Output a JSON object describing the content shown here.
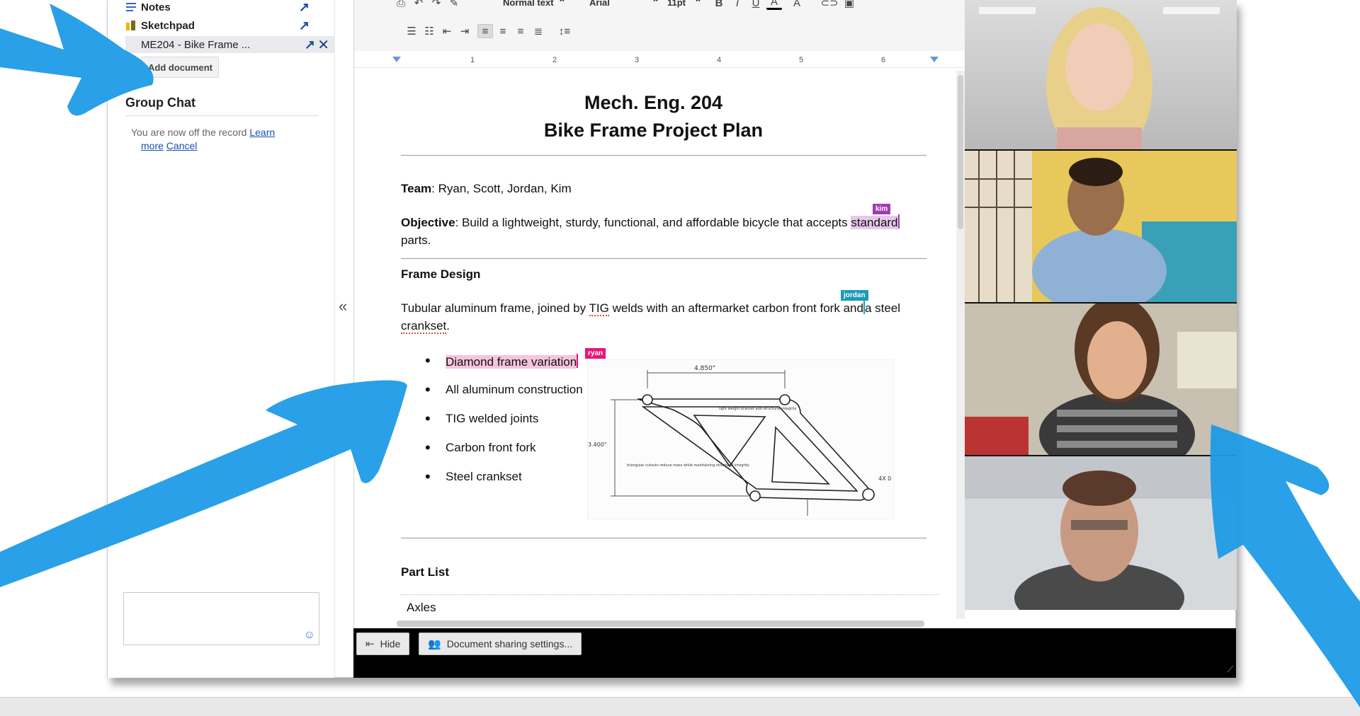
{
  "sidebar": {
    "docs": [
      {
        "label": "Notes"
      },
      {
        "label": "Sketchpad"
      },
      {
        "label": "ME204 - Bike Frame ..."
      }
    ],
    "add_document": "Add document",
    "group_chat_title": "Group Chat",
    "chat_message": {
      "text": "You are now off the record",
      "learn": "Learn",
      "more": "more",
      "cancel": "Cancel"
    }
  },
  "toolbar": {
    "style": "Normal text",
    "font": "Arial",
    "size": "11pt"
  },
  "ruler": {
    "numbers": [
      "1",
      "2",
      "3",
      "4",
      "5",
      "6"
    ]
  },
  "document": {
    "title_line1": "Mech. Eng. 204",
    "title_line2": "Bike Frame Project Plan",
    "team_label": "Team",
    "team_text": ": Ryan, Scott, Jordan, Kim",
    "objective_label": "Objective",
    "objective_text": ": Build a lightweight, sturdy, functional, and affordable bicycle that accepts ",
    "objective_highlight": "standard",
    "objective_end": "parts.",
    "frame_design": "Frame Design",
    "frame_text_1": "Tubular aluminum frame, joined by ",
    "frame_tig": "TIG",
    "frame_text_2": " welds with an aftermarket carbon front fork and",
    "frame_text_3": "a steel",
    "frame_crankset": "crankset",
    "frame_period": ".",
    "bullets": [
      "Diamond frame variation",
      "All aluminum construction",
      "TIG welded joints",
      "Carbon front fork",
      "Steel crankset"
    ],
    "part_list": "Part List",
    "table_first": "Axles",
    "drawing_labels": {
      "top": "4.850\"",
      "left": "3.400\"",
      "right": "4X 0",
      "note1": "light weight bracket add structural integrity",
      "note2": "triangular cutouts reduce mass while maintaining structural integrity"
    }
  },
  "cursors": {
    "kim": {
      "name": "kim",
      "color": "#a23bb3"
    },
    "jordan": {
      "name": "jordan",
      "color": "#1a9bb7"
    },
    "ryan": {
      "name": "ryan",
      "color": "#e8157a"
    }
  },
  "bottom_bar": {
    "hide": "Hide",
    "sharing": "Document sharing settings..."
  },
  "colors": {
    "arrow": "#1e9be6",
    "accent_link": "#1a4fb3"
  }
}
